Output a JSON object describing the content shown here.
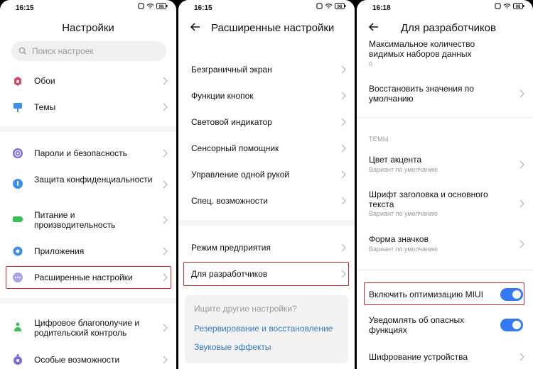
{
  "screen1": {
    "time": "16:15",
    "battery": "98",
    "title": "Настройки",
    "search_placeholder": "Поиск настроек",
    "items": [
      {
        "label": "Обои",
        "icon": "wallpaper-icon"
      },
      {
        "label": "Темы",
        "icon": "themes-icon"
      },
      {
        "label": "Пароли и безопасность",
        "icon": "fingerprint-icon"
      },
      {
        "label": "Защита конфиденциальности",
        "icon": "privacy-icon"
      },
      {
        "label": "Питание и производительность",
        "icon": "battery-icon"
      },
      {
        "label": "Приложения",
        "icon": "gear-icon"
      },
      {
        "label": "Расширенные настройки",
        "icon": "more-icon"
      },
      {
        "label": "Цифровое благополучие и родительский контроль",
        "icon": "wellbeing-icon"
      },
      {
        "label": "Особые возможности",
        "icon": "accessibility-icon"
      }
    ]
  },
  "screen2": {
    "time": "16:15",
    "battery": "98",
    "title": "Расширенные настройки",
    "items": [
      {
        "label": "Безграничный экран"
      },
      {
        "label": "Функции кнопок"
      },
      {
        "label": "Световой индикатор"
      },
      {
        "label": "Сенсорный помощник"
      },
      {
        "label": "Управление одной рукой"
      },
      {
        "label": "Спец. возможности"
      },
      {
        "label": "Режим предприятия"
      },
      {
        "label": "Для разработчиков"
      }
    ],
    "suggest": {
      "question": "Ищите другие настройки?",
      "links": [
        "Резервирование и восстановление",
        "Звуковые эффекты"
      ]
    }
  },
  "screen3": {
    "time": "16:18",
    "battery": "98",
    "title": "Для разработчиков",
    "items": [
      {
        "label": "Максимальное количество видимых наборов данных",
        "sub": "0"
      },
      {
        "label": "Восстановить значения по умолчанию",
        "sub": ""
      },
      {
        "label": "Цвет акцента",
        "sub": "Вариант по умолчанию"
      },
      {
        "label": "Шрифт заголовка и основного текста",
        "sub": "Вариант по умолчанию"
      },
      {
        "label": "Форма значков",
        "sub": "Вариант по умолчанию"
      },
      {
        "label": "Включить оптимизацию MIUI",
        "sub": ""
      },
      {
        "label": "Уведомлять об опасных функциях",
        "sub": ""
      },
      {
        "label": "Шифрование устройства",
        "sub": ""
      }
    ],
    "section": "ТЕМЫ",
    "toggles": {
      "miui_optimization": true,
      "warn_dangerous": true
    }
  },
  "colors": {
    "accent": "#3478f6",
    "highlight": "#cc2a2a",
    "link": "#3478c6"
  }
}
